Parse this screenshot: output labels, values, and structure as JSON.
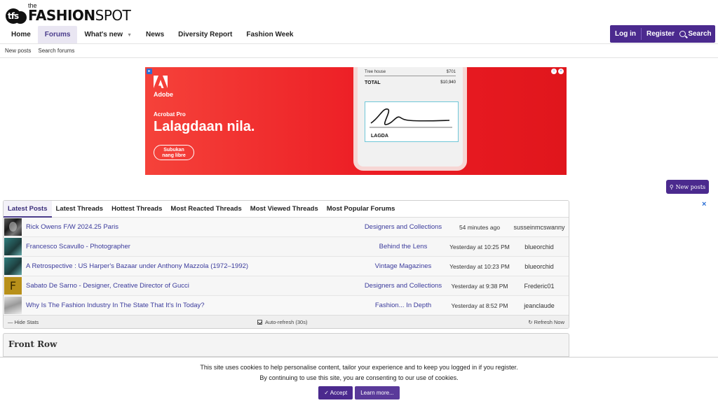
{
  "logo": {
    "the": "the",
    "name_bold": "FASHION",
    "name_light": "SPOT",
    "mark": "tfs"
  },
  "nav": {
    "items": [
      {
        "label": "Home"
      },
      {
        "label": "Forums"
      },
      {
        "label": "What's new"
      },
      {
        "label": "News"
      },
      {
        "label": "Diversity Report"
      },
      {
        "label": "Fashion Week"
      }
    ],
    "login": "Log in",
    "register": "Register",
    "search": "Search"
  },
  "subnav": {
    "items": [
      "New posts",
      "Search forums"
    ]
  },
  "ad": {
    "brand": "Adobe",
    "product": "Acrobat Pro",
    "headline": "Lalagdaan nila.",
    "cta_line1": "Subukan",
    "cta_line2": "nang libre",
    "phone_item": "Tree house",
    "phone_item_value": "$701",
    "total_label": "TOTAL",
    "total_value": "$10,940",
    "sign_label": "LAGDA"
  },
  "new_posts_button": "New posts",
  "widget": {
    "tabs": [
      "Latest Posts",
      "Latest Threads",
      "Hottest Threads",
      "Most Reacted Threads",
      "Most Viewed Threads",
      "Most Popular Forums"
    ],
    "rows": [
      {
        "title": "Rick Owens F/W 2024.25 Paris",
        "forum": "Designers and Collections",
        "time": "54 minutes ago",
        "user": "susseinmcswanny",
        "avatar": "photo"
      },
      {
        "title": "Francesco Scavullo - Photographer",
        "forum": "Behind the Lens",
        "time": "Yesterday at 10:25 PM",
        "user": "blueorchid",
        "avatar": "teal"
      },
      {
        "title": "A Retrospective : US Harper's Bazaar under Anthony Mazzola (1972–1992)",
        "forum": "Vintage Magazines",
        "time": "Yesterday at 10:23 PM",
        "user": "blueorchid",
        "avatar": "teal"
      },
      {
        "title": "Sabato De Sarno - Designer, Creative Director of Gucci",
        "forum": "Designers and Collections",
        "time": "Yesterday at 9:38 PM",
        "user": "Frederic01",
        "avatar": "letter",
        "letter": "F"
      },
      {
        "title": "Why Is The Fashion Industry In The State That It's In Today?",
        "forum": "Fashion... In Depth",
        "time": "Yesterday at 8:52 PM",
        "user": "jeanclaude",
        "avatar": "sketch"
      }
    ],
    "footer": {
      "hide": "— Hide Stats",
      "auto": "Auto-refresh (30s)",
      "refresh": "Refresh Now"
    }
  },
  "front_row": {
    "title": "Front Row"
  },
  "cookie": {
    "line1": "This site uses cookies to help personalise content, tailor your experience and to keep you logged in if you register.",
    "line2": "By continuing to use this site, you are consenting to our use of cookies.",
    "accept": "Accept",
    "learn": "Learn more..."
  }
}
